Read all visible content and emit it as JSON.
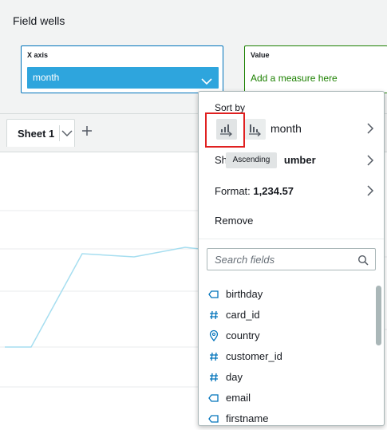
{
  "field_wells": {
    "title": "Field wells",
    "x_axis": {
      "label": "X axis",
      "field": "month"
    },
    "value": {
      "label": "Value",
      "placeholder": "Add a measure here"
    }
  },
  "sheets": {
    "tabs": [
      {
        "label": "Sheet 1"
      }
    ],
    "add_icon": "plus-icon"
  },
  "chart": {
    "type": "line",
    "line_color": "#a6def0",
    "grid": true
  },
  "popup": {
    "sort_by_label": "Sort by",
    "sort_ascending_icon": "sort-ascending-icon",
    "sort_descending_icon": "sort-descending-icon",
    "sort_field": "month",
    "tooltip": "Ascending",
    "show_as_prefix": "Sh",
    "show_as_suffix": "umber",
    "format_label": "Format:",
    "format_value": "1,234.57",
    "remove_label": "Remove",
    "search_placeholder": "Search fields",
    "fields": [
      {
        "name": "birthday",
        "type": "date",
        "icon": "date-icon"
      },
      {
        "name": "card_id",
        "type": "numeric",
        "icon": "hash-icon"
      },
      {
        "name": "country",
        "type": "geo",
        "icon": "location-pin-icon"
      },
      {
        "name": "customer_id",
        "type": "numeric",
        "icon": "hash-icon"
      },
      {
        "name": "day",
        "type": "numeric",
        "icon": "hash-icon"
      },
      {
        "name": "email",
        "type": "string",
        "icon": "tag-icon"
      },
      {
        "name": "firstname",
        "type": "string",
        "icon": "tag-icon"
      }
    ]
  },
  "colors": {
    "accent": "#0073bb",
    "pill": "#2ea5dd",
    "value_green": "#1d8102",
    "highlight_red": "#e02020"
  }
}
